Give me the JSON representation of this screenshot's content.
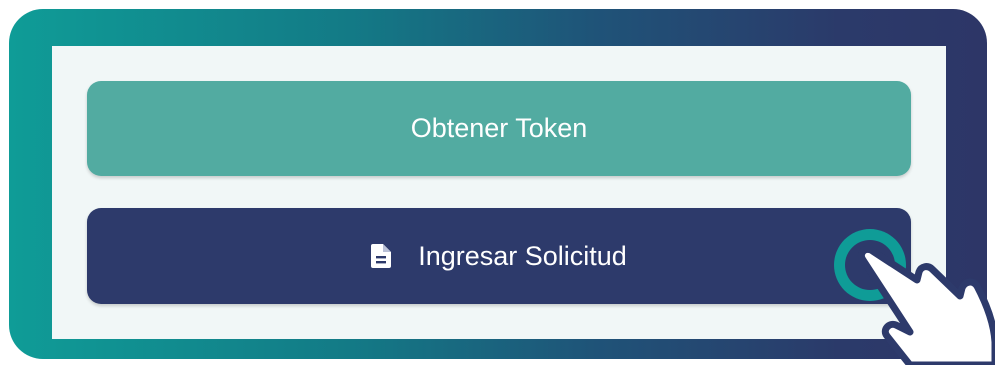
{
  "buttons": {
    "token_label": "Obtener Token",
    "solicitud_label": "Ingresar Solicitud",
    "solicitud_icon": "document-icon"
  },
  "colors": {
    "frame_gradient_start": "#0f9c97",
    "frame_gradient_end": "#2d3667",
    "panel_background": "#f1f7f7",
    "token_button": "#52aba1",
    "solicitud_button": "#2d3a6b",
    "tap_ring": "#0f9c97"
  },
  "overlay": {
    "pointer_icon": "hand-pointer-icon"
  }
}
